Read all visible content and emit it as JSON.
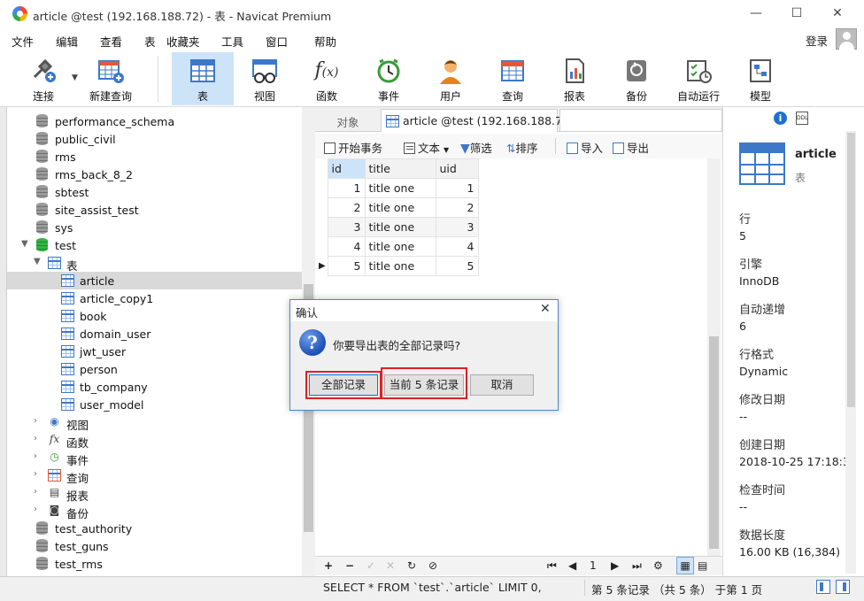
{
  "window": {
    "title": "article @test (192.168.188.72) - 表 - Navicat Premium",
    "controls": [
      "—",
      "☐",
      "✕"
    ]
  },
  "menu": [
    "文件",
    "编辑",
    "查看",
    "表",
    "收藏夹",
    "工具",
    "窗口",
    "帮助"
  ],
  "login": "登录",
  "toolbar": [
    {
      "label": "连接",
      "icon": "connect-icon"
    },
    {
      "label": "新建查询",
      "icon": "new-query-icon"
    },
    {
      "label": "表",
      "icon": "table-icon",
      "selected": true
    },
    {
      "label": "视图",
      "icon": "view-icon"
    },
    {
      "label": "函数",
      "icon": "function-icon"
    },
    {
      "label": "事件",
      "icon": "event-icon"
    },
    {
      "label": "用户",
      "icon": "user-icon"
    },
    {
      "label": "查询",
      "icon": "query-icon"
    },
    {
      "label": "报表",
      "icon": "report-icon"
    },
    {
      "label": "备份",
      "icon": "backup-icon"
    },
    {
      "label": "自动运行",
      "icon": "automation-icon"
    },
    {
      "label": "模型",
      "icon": "model-icon"
    }
  ],
  "tree": {
    "databases_top": [
      "performance_schema",
      "public_civil",
      "rms",
      "rms_back_8_2",
      "sbtest",
      "site_assist_test",
      "sys"
    ],
    "open_db": "test",
    "tables_node": "表",
    "tables": [
      "article",
      "article_copy1",
      "book",
      "domain_user",
      "jwt_user",
      "person",
      "tb_company",
      "user_model"
    ],
    "selected_table": "article",
    "groups": [
      "视图",
      "函数",
      "事件",
      "查询",
      "报表",
      "备份"
    ],
    "databases_bottom": [
      "test_authority",
      "test_guns",
      "test_rms"
    ]
  },
  "tabs": {
    "objects": "对象",
    "active": "article @test (192.168.188.7..."
  },
  "data_toolbar": {
    "begin_tx": "开始事务",
    "text": "文本",
    "filter": "筛选",
    "sort": "排序",
    "import": "导入",
    "export": "导出"
  },
  "grid": {
    "columns": [
      "id",
      "title",
      "uid"
    ],
    "rows": [
      [
        "1",
        "title one",
        "1"
      ],
      [
        "2",
        "title one",
        "2"
      ],
      [
        "3",
        "title one",
        "3"
      ],
      [
        "4",
        "title one",
        "4"
      ],
      [
        "5",
        "title one",
        "5"
      ]
    ]
  },
  "navbar": {
    "page": "1"
  },
  "info": {
    "name": "article",
    "type": "表",
    "rows_label": "行",
    "rows": "5",
    "engine_label": "引擎",
    "engine": "InnoDB",
    "autoinc_label": "自动递增",
    "autoinc": "6",
    "rowfmt_label": "行格式",
    "rowfmt": "Dynamic",
    "modified_label": "修改日期",
    "modified": "--",
    "created_label": "创建日期",
    "created": "2018-10-25 17:18:3",
    "checked_label": "检查时间",
    "checked": "--",
    "length_label": "数据长度",
    "length": "16.00 KB (16,384)"
  },
  "status": {
    "sql": "SELECT * FROM `test`.`article` LIMIT 0,",
    "records": "第 5 条记录 （共 5 条） 于第 1 页"
  },
  "dialog": {
    "title": "确认",
    "message": "你要导出表的全部记录吗?",
    "buttons": {
      "all": "全部记录",
      "current": "当前 5 条记录",
      "cancel": "取消"
    }
  }
}
